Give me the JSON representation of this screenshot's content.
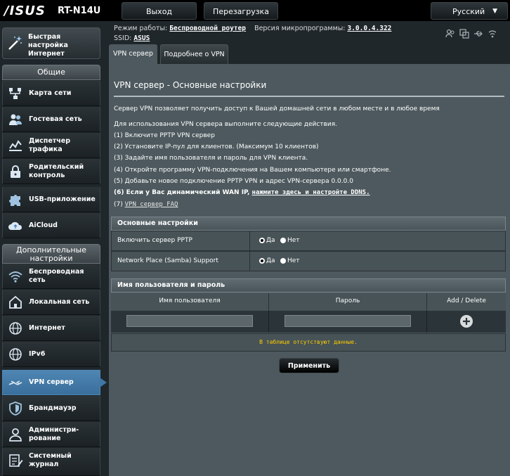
{
  "header": {
    "brand": "/ISUS",
    "model": "RT-N14U",
    "logout_label": "Выход",
    "reboot_label": "Перезагрузка",
    "language": "Русский"
  },
  "info": {
    "mode_label": "Режим работы:",
    "mode_value": "Беспроводной роутер",
    "firmware_label": "Версия микропрограммы:",
    "firmware_value": "3.0.0.4.322",
    "ssid_label": "SSID:",
    "ssid_value": "ASUS"
  },
  "sidebar": {
    "qis_label": "Быстрая настройка Интернет",
    "general_header": "Общие",
    "general_items": [
      {
        "label": "Карта сети",
        "icon": "network-map-icon"
      },
      {
        "label": "Гостевая сеть",
        "icon": "guest-network-icon"
      },
      {
        "label": "Диспетчер трафика",
        "icon": "traffic-manager-icon"
      },
      {
        "label": "Родительский контроль",
        "icon": "parental-control-icon"
      },
      {
        "label": "USB-приложение",
        "icon": "usb-app-icon"
      },
      {
        "label": "AiCloud",
        "icon": "aicloud-icon"
      }
    ],
    "advanced_header": "Дополнительные настройки",
    "advanced_items": [
      {
        "label": "Беспроводная сеть",
        "icon": "wireless-icon"
      },
      {
        "label": "Локальная сеть",
        "icon": "lan-icon"
      },
      {
        "label": "Интернет",
        "icon": "internet-icon"
      },
      {
        "label": "IPv6",
        "icon": "ipv6-icon"
      },
      {
        "label": "VPN сервер",
        "icon": "vpn-icon",
        "active": true
      },
      {
        "label": "Брандмауэр",
        "icon": "firewall-icon"
      },
      {
        "label": "Администри-рование",
        "icon": "administration-icon"
      },
      {
        "label": "Системный журнал",
        "icon": "system-log-icon"
      }
    ]
  },
  "tabs": [
    {
      "label": "VPN сервер",
      "active": true
    },
    {
      "label": "Подробнее о VPN",
      "active": false
    }
  ],
  "content": {
    "title": "VPN сервер - Основные настройки",
    "intro": "Сервер VPN позволяет получить доступ к Вашей домашней сети в любом месте и в любое время",
    "steps_intro": "Для использования VPN сервера выполните следующие действия.",
    "steps": [
      "(1) Включите PPTP VPN сервер",
      "(2) Установите IP-пул для клиентов. (Максимум 10 клиентов)",
      "(3) Задайте имя пользователя и пароль для VPN клиента.",
      "(4) Откройте программу VPN-подключения на Вашем компьютере или смартфоне.",
      "(5) Добавьте новое подключение PPTP VPN и адрес VPN-сервера 0.0.0.0"
    ],
    "step6_text": "(6) Если у Вас динамический WAN IP, ",
    "step6_link": "нажмите здесь и настройте DDNS.",
    "step7_prefix": "(7) ",
    "step7_link": "VPN сервер FAQ"
  },
  "basic_settings": {
    "header": "Основные настройки",
    "rows": [
      {
        "label": "Включить сервер PPTP",
        "yes": "Да",
        "no": "Нет",
        "selected": "yes"
      },
      {
        "label": "Network Place (Samba) Support",
        "yes": "Да",
        "no": "Нет",
        "selected": "yes"
      }
    ]
  },
  "users": {
    "header": "Имя пользователя и пароль",
    "col_username": "Имя пользователя",
    "col_password": "Пароль",
    "col_action": "Add / Delete",
    "empty_message": "В таблице отсутствуют данные."
  },
  "apply_label": "Применить"
}
